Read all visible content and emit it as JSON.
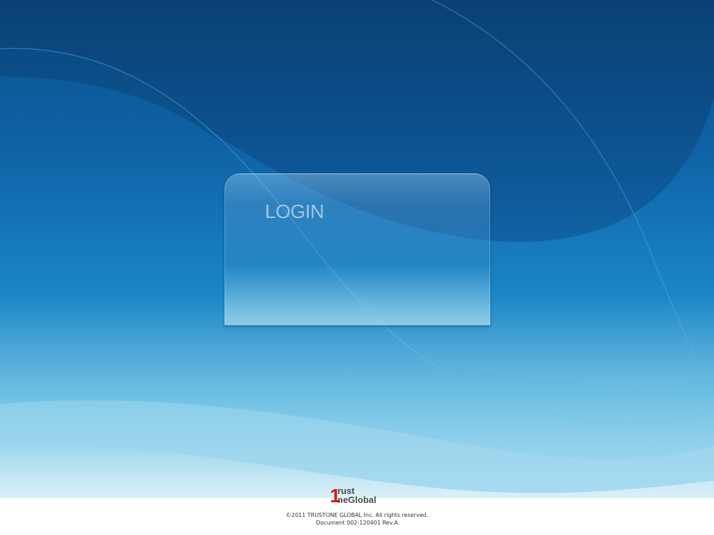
{
  "login_panel": {
    "title": "LOGIN"
  },
  "logo": {
    "number": "1",
    "line1": "rust",
    "line2": "neGlobal",
    "brand_color": "#d11a1a"
  },
  "footer": {
    "copyright": "©2011 TRUSTONE GLOBAL Inc. All rights reserved.",
    "document": "Document 002-120401 Rev.A"
  },
  "colors": {
    "background_dark": "#0b4f8c",
    "background_mid": "#1a86c6",
    "background_light": "#e9f5fa"
  }
}
